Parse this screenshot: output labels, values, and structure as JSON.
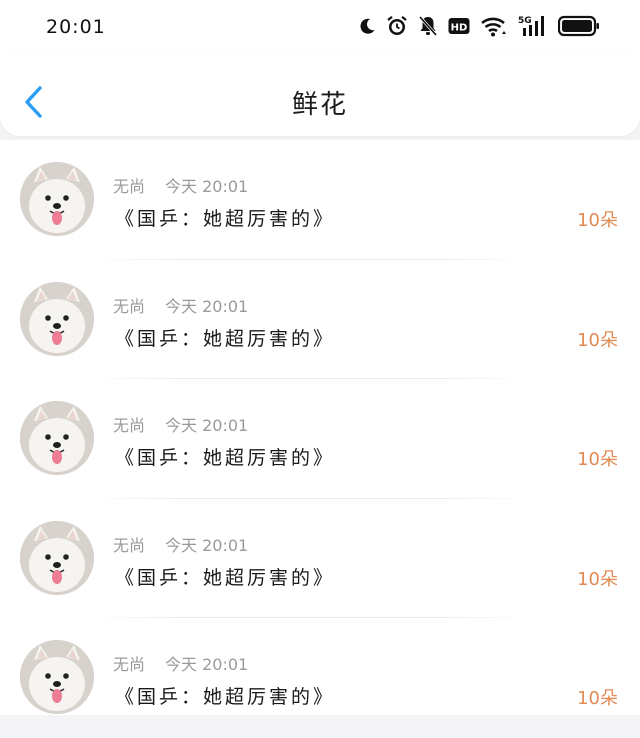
{
  "status_bar": {
    "time": "20:01",
    "icons": [
      "moon-icon",
      "alarm-icon",
      "bell-mute-icon",
      "hd-icon",
      "wifi-icon",
      "signal-5g-icon",
      "battery-icon"
    ],
    "hd_label": "HD",
    "network_label": "5G"
  },
  "header": {
    "title": "鲜花",
    "back_icon": "chevron-left-icon"
  },
  "colors": {
    "accent_blue": "#2a9df4",
    "count_orange": "#e38a55",
    "meta_gray": "#9a9a9a"
  },
  "records": [
    {
      "user": "无尚",
      "time": "今天 20:01",
      "title": "《国乒：她超厉害的》",
      "count": "10朵"
    },
    {
      "user": "无尚",
      "time": "今天 20:01",
      "title": "《国乒：她超厉害的》",
      "count": "10朵"
    },
    {
      "user": "无尚",
      "time": "今天 20:01",
      "title": "《国乒：她超厉害的》",
      "count": "10朵"
    },
    {
      "user": "无尚",
      "time": "今天 20:01",
      "title": "《国乒：她超厉害的》",
      "count": "10朵"
    },
    {
      "user": "无尚",
      "time": "今天 20:01",
      "title": "《国乒：她超厉害的》",
      "count": "10朵"
    }
  ]
}
